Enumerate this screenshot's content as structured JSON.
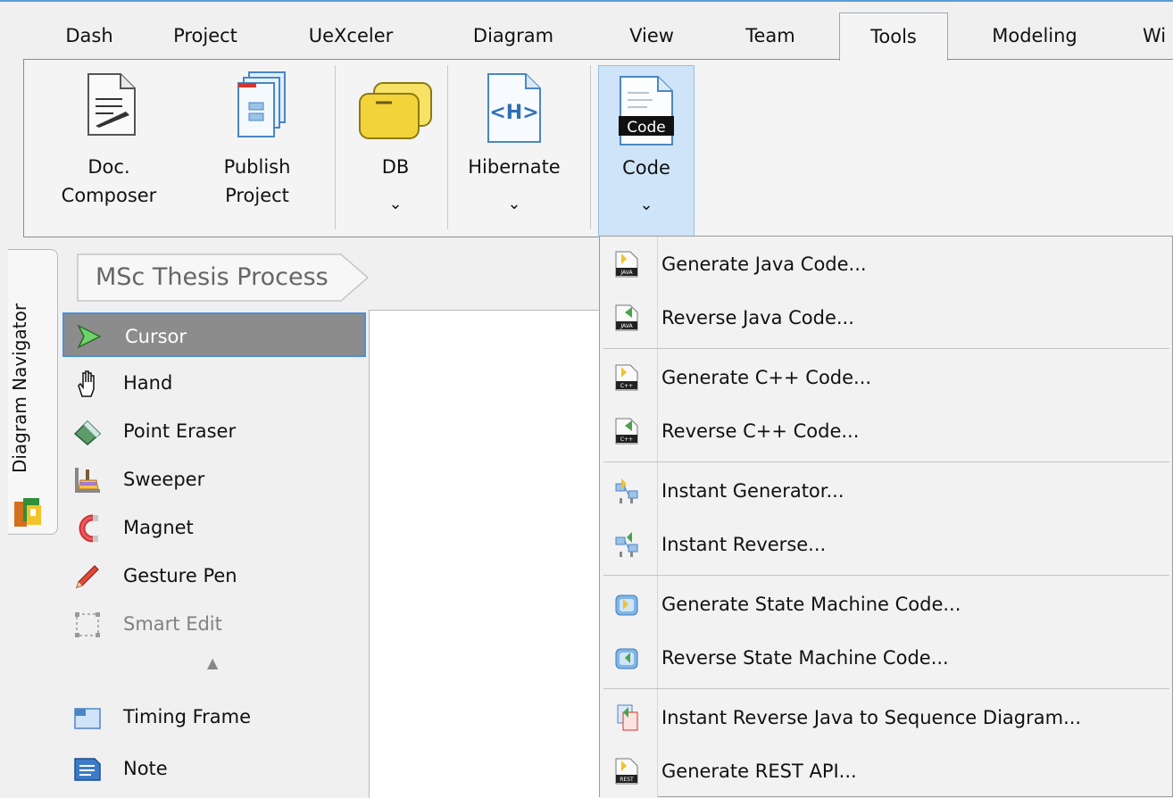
{
  "menubar": {
    "tabs": [
      {
        "label": "Dash"
      },
      {
        "label": "Project"
      },
      {
        "label": "UeXceler"
      },
      {
        "label": "Diagram"
      },
      {
        "label": "View"
      },
      {
        "label": "Team"
      },
      {
        "label": "Tools"
      },
      {
        "label": "Modeling"
      },
      {
        "label": "Wi"
      }
    ],
    "active_tab": "Tools"
  },
  "ribbon": {
    "doc_composer": {
      "line1": "Doc.",
      "line2": "Composer"
    },
    "publish_project": {
      "line1": "Publish",
      "line2": "Project"
    },
    "db": {
      "label": "DB",
      "chevron": "⌄"
    },
    "hibernate": {
      "label": "Hibernate",
      "chevron": "⌄",
      "icon_text": "<H>"
    },
    "code": {
      "label": "Code",
      "chevron": "⌄",
      "icon_text": "Code"
    }
  },
  "navigator": {
    "label": "Diagram Navigator"
  },
  "breadcrumb": {
    "label": "MSc Thesis Process"
  },
  "palette": {
    "items": [
      {
        "label": "Cursor",
        "icon": "cursor-arrow-icon"
      },
      {
        "label": "Hand",
        "icon": "hand-icon"
      },
      {
        "label": "Point Eraser",
        "icon": "eraser-icon"
      },
      {
        "label": "Sweeper",
        "icon": "sweeper-icon"
      },
      {
        "label": "Magnet",
        "icon": "magnet-icon"
      },
      {
        "label": "Gesture Pen",
        "icon": "pen-icon"
      },
      {
        "label": "Smart Edit",
        "icon": "smart-edit-icon"
      },
      {
        "label": "Timing Frame",
        "icon": "timing-frame-icon"
      },
      {
        "label": "Note",
        "icon": "note-icon"
      }
    ],
    "collapse_glyph": "▲"
  },
  "code_menu": {
    "items": [
      {
        "label": "Generate Java Code...",
        "icon_text": "JAVA"
      },
      {
        "label": "Reverse Java Code...",
        "icon_text": "JAVA"
      },
      {
        "label": "Generate C++ Code...",
        "icon_text": "C++"
      },
      {
        "label": "Reverse C++ Code...",
        "icon_text": "C++"
      },
      {
        "label": "Instant Generator..."
      },
      {
        "label": "Instant Reverse..."
      },
      {
        "label": "Generate State Machine Code..."
      },
      {
        "label": "Reverse State Machine Code..."
      },
      {
        "label": "Instant Reverse Java to Sequence Diagram..."
      },
      {
        "label": "Generate REST API...",
        "icon_text": "REST"
      }
    ]
  },
  "colors": {
    "accent": "#5b9bd5",
    "code_button_bg": "#cfe4f8",
    "cursor_selected_bg": "#8c8c8c",
    "db_yellow": "#f2d43a"
  }
}
